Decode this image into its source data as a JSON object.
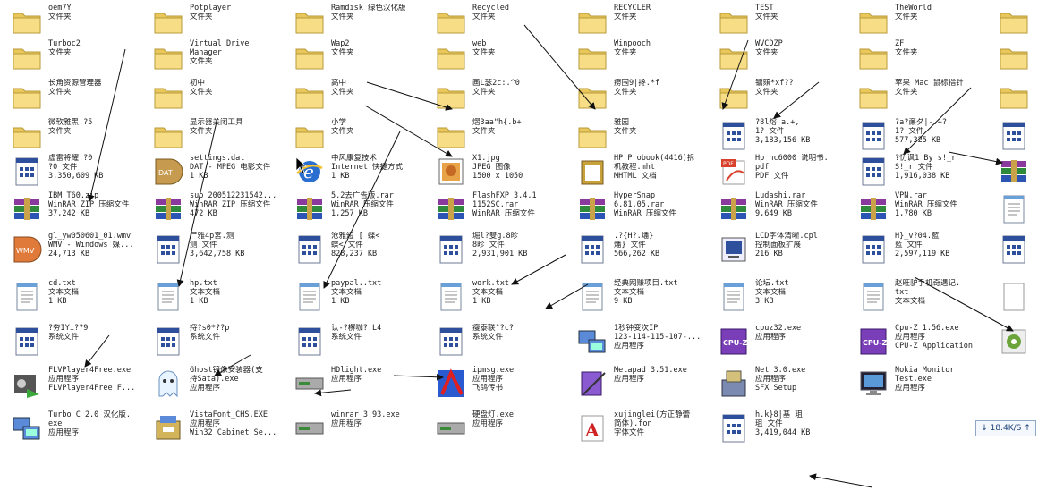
{
  "items": [
    {
      "icon": "folder",
      "lines": [
        "oem7Y",
        "文件夹"
      ]
    },
    {
      "icon": "folder",
      "lines": [
        "Potplayer",
        "文件夹"
      ]
    },
    {
      "icon": "folder",
      "lines": [
        "Ramdisk 绿色汉化版",
        "文件夹"
      ]
    },
    {
      "icon": "folder",
      "lines": [
        "Recycled",
        "文件夹"
      ]
    },
    {
      "icon": "folder",
      "lines": [
        "RECYCLER",
        "文件夹"
      ]
    },
    {
      "icon": "folder",
      "lines": [
        "TEST",
        "文件夹"
      ]
    },
    {
      "icon": "folder",
      "lines": [
        "TheWorld",
        "文件夹"
      ]
    },
    {
      "icon": "folder",
      "lines": []
    },
    {
      "icon": "folder",
      "lines": [
        "Turboc2",
        "文件夹"
      ]
    },
    {
      "icon": "folder",
      "lines": [
        "Virtual Drive",
        "Manager",
        "文件夹"
      ]
    },
    {
      "icon": "folder",
      "lines": [
        "Wap2",
        "文件夹"
      ]
    },
    {
      "icon": "folder",
      "lines": [
        "web",
        "文件夹"
      ]
    },
    {
      "icon": "folder",
      "lines": [
        "Winpooch",
        "文件夹"
      ]
    },
    {
      "icon": "folder",
      "lines": [
        "WVCDZP",
        "文件夹"
      ]
    },
    {
      "icon": "folder",
      "lines": [
        "ZF",
        "文件夹"
      ]
    },
    {
      "icon": "folder",
      "lines": []
    },
    {
      "icon": "folder",
      "lines": [
        "长角资源管理器",
        "文件夹"
      ]
    },
    {
      "icon": "folder",
      "lines": [
        "初中",
        "文件夹"
      ]
    },
    {
      "icon": "folder",
      "lines": [
        "高中",
        "文件夹"
      ]
    },
    {
      "icon": "folder",
      "lines": [
        "画L瑟2c:.^0",
        "文件夹"
      ]
    },
    {
      "icon": "folder",
      "lines": [
        "痨围9|搀.*f",
        "文件夹"
      ]
    },
    {
      "icon": "folder",
      "lines": [
        "镛頦*xf??",
        "文件夹"
      ]
    },
    {
      "icon": "folder",
      "lines": [
        "苹果 Mac 鼠标指针",
        "文件夹"
      ]
    },
    {
      "icon": "folder",
      "lines": []
    },
    {
      "icon": "folder",
      "lines": [
        "微软雅黑.?5",
        "文件夹"
      ]
    },
    {
      "icon": "folder",
      "lines": [
        "显示器关闭工具",
        "文件夹"
      ]
    },
    {
      "icon": "folder",
      "lines": [
        "小学",
        "文件夹"
      ]
    },
    {
      "icon": "folder",
      "lines": [
        "熠3aa\"h{.b+",
        "文件夹"
      ]
    },
    {
      "icon": "folder",
      "lines": [
        "雅园",
        "文件夹"
      ]
    },
    {
      "icon": "sysfile",
      "lines": [
        "?8l熔 a.+,",
        "1? 文件",
        "3,183,156 KB"
      ]
    },
    {
      "icon": "sysfile",
      "lines": [
        "?a?亷ダ|-.+?",
        "1? 文件",
        "577,325 KB"
      ]
    },
    {
      "icon": "sysfile",
      "lines": []
    },
    {
      "icon": "sysfile",
      "lines": [
        "虛雷將耀.?0",
        "?0 文件",
        "3,350,609 KB"
      ]
    },
    {
      "icon": "dat",
      "lines": [
        "settings.dat",
        "DAT - MPEG 电影文件",
        "1 KB"
      ]
    },
    {
      "icon": "ie",
      "lines": [
        "中风康复技术",
        "Internet 快捷方式",
        "1 KB"
      ]
    },
    {
      "icon": "jpg",
      "lines": [
        "X1.jpg",
        "JPEG 图像",
        "1500 x 1050"
      ]
    },
    {
      "icon": "mht",
      "lines": [
        "HP Probook(4416)拆",
        "机教程.mht",
        "MHTML 文档"
      ]
    },
    {
      "icon": "pdf",
      "lines": [
        "Hp nc6000 说明书.",
        "pdf",
        "PDF 文件"
      ]
    },
    {
      "icon": "sysfile",
      "lines": [
        "?忉讽1 By s!_r",
        "S!_r 文件",
        "1,916,038 KB"
      ]
    },
    {
      "icon": "rar",
      "lines": []
    },
    {
      "icon": "rar",
      "lines": [
        "IBM T60.zip",
        "WinRAR ZIP 压缩文件",
        "37,242 KB"
      ]
    },
    {
      "icon": "rar",
      "lines": [
        "sup_200512231542...",
        "WinRAR ZIP 压缩文件",
        "472 KB"
      ]
    },
    {
      "icon": "rar",
      "lines": [
        "5.2去广告版.rar",
        "WinRAR 压缩文件",
        "1,257 KB"
      ]
    },
    {
      "icon": "rar",
      "lines": [
        "FlashFXP 3.4.1",
        "1152SC.rar",
        "WinRAR 压缩文件"
      ]
    },
    {
      "icon": "rar",
      "lines": [
        "HyperSnap",
        "6.81.05.rar",
        "WinRAR 压缩文件"
      ]
    },
    {
      "icon": "rar",
      "lines": [
        "Ludashi.rar",
        "WinRAR 压缩文件",
        "9,649 KB"
      ]
    },
    {
      "icon": "rar",
      "lines": [
        "VPN.rar",
        "WinRAR 压缩文件",
        "1,780 KB"
      ]
    },
    {
      "icon": "txt",
      "lines": []
    },
    {
      "icon": "wmv",
      "lines": [
        "gl_yw050601_01.wmv",
        "WMV - Windows 媒...",
        "24,713 KB"
      ]
    },
    {
      "icon": "sysfile",
      "lines": [
        "尸雅4p宮.测",
        "测 文件",
        "3,642,758 KB"
      ]
    },
    {
      "icon": "sysfile",
      "lines": [
        "沧雅短 [ 蝶<",
        "蝶< 文件",
        "828,237 KB"
      ]
    },
    {
      "icon": "sysfile",
      "lines": [
        "堀l?雙g.8昣",
        "8昣 文件",
        "2,931,901 KB"
      ]
    },
    {
      "icon": "sysfile",
      "lines": [
        ".?{H?.燔}",
        "燔} 文件",
        "566,262 KB"
      ]
    },
    {
      "icon": "cpl",
      "lines": [
        "LCD字体清晰.cpl",
        "控制面板扩展",
        "216 KB"
      ]
    },
    {
      "icon": "sysfile",
      "lines": [
        "H}_v?04.藍",
        "藍 文件",
        "2,597,119 KB"
      ]
    },
    {
      "icon": "sysfile",
      "lines": []
    },
    {
      "icon": "txt",
      "lines": [
        "cd.txt",
        "文本文档",
        "1 KB"
      ]
    },
    {
      "icon": "txt",
      "lines": [
        "hp.txt",
        "文本文档",
        "1 KB"
      ]
    },
    {
      "icon": "txt",
      "lines": [
        "paypal..txt",
        "文本文档",
        "1 KB"
      ]
    },
    {
      "icon": "txt",
      "lines": [
        "work.txt",
        "文本文档",
        "1 KB"
      ]
    },
    {
      "icon": "txt",
      "lines": [
        "经典网赚项目.txt",
        "文本文档",
        "9 KB"
      ]
    },
    {
      "icon": "txt",
      "lines": [
        "论坛.txt",
        "文本文档",
        "3 KB"
      ]
    },
    {
      "icon": "txt",
      "lines": [
        "赵旺驴手机奇遇记.",
        "txt",
        "文本文档"
      ]
    },
    {
      "icon": "generic",
      "lines": []
    },
    {
      "icon": "sysfile",
      "lines": [
        "?夯IYi??9",
        "系统文件"
      ]
    },
    {
      "icon": "sysfile",
      "lines": [
        "捋?s0*??p",
        "系统文件"
      ]
    },
    {
      "icon": "sysfile",
      "lines": [
        "认-?楐咖? L4",
        "系统文件"
      ]
    },
    {
      "icon": "sysfile",
      "lines": [
        "瘦泰联\"?c?",
        "系统文件"
      ]
    },
    {
      "icon": "network",
      "lines": [
        "1秒钟变次IP",
        "123-114-115-107-...",
        "应用程序"
      ]
    },
    {
      "icon": "cpuz",
      "lines": [
        "cpuz32.exe",
        "应用程序"
      ]
    },
    {
      "icon": "cpuz",
      "lines": [
        "Cpu-Z 1.56.exe",
        "应用程序",
        "CPU-Z Application"
      ]
    },
    {
      "icon": "gear",
      "lines": []
    },
    {
      "icon": "film",
      "lines": [
        "FLVPlayer4Free.exe",
        "应用程序",
        "FLVPlayer4Free F..."
      ]
    },
    {
      "icon": "ghost",
      "lines": [
        "Ghost镜像安装器(支",
        "持Sata).exe",
        "应用程序"
      ]
    },
    {
      "icon": "drive",
      "lines": [
        "HDlight.exe",
        "应用程序"
      ]
    },
    {
      "icon": "ipmsg",
      "lines": [
        "ipmsg.exe",
        "应用程序",
        "飞鸽传书"
      ]
    },
    {
      "icon": "notepad",
      "lines": [
        "Metapad 3.51.exe",
        "应用程序"
      ]
    },
    {
      "icon": "setup",
      "lines": [
        "Net 3.0.exe",
        "应用程序",
        "SFX Setup"
      ]
    },
    {
      "icon": "monitor",
      "lines": [
        "Nokia Monitor",
        "Test.exe",
        "应用程序"
      ]
    },
    {
      "icon": "none",
      "lines": []
    },
    {
      "icon": "network",
      "lines": [
        "Turbo C 2.0 汉化版.",
        "exe",
        "应用程序"
      ]
    },
    {
      "icon": "cab",
      "lines": [
        "VistaFont_CHS.EXE",
        "应用程序",
        "Win32 Cabinet Se..."
      ]
    },
    {
      "icon": "drive",
      "lines": [
        "winrar 3.93.exe",
        "应用程序"
      ]
    },
    {
      "icon": "drive",
      "lines": [
        "硬盘灯.exe",
        "应用程序"
      ]
    },
    {
      "icon": "font",
      "lines": [
        "xujinglei(方正静蕾",
        "简体).fon",
        "字体文件"
      ]
    },
    {
      "icon": "sysfile",
      "lines": [
        "h.k}8|基 珇",
        "珇 文件",
        "3,419,044 KB"
      ]
    },
    {
      "icon": "none",
      "lines": []
    },
    {
      "icon": "none",
      "lines": []
    }
  ],
  "speed_widget": {
    "text": "↓ 18.4K/S ↑"
  },
  "colors": {
    "folder": "#f2d77a",
    "folder_edge": "#b89a3a",
    "arrow": "#111111"
  }
}
